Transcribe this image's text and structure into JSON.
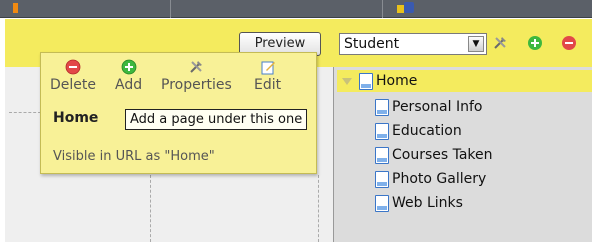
{
  "toolbar": {
    "preview_label": "Preview",
    "role_select_value": "Student"
  },
  "popup": {
    "actions": [
      {
        "label": "Delete",
        "icon": "delete-icon"
      },
      {
        "label": "Add",
        "icon": "add-icon"
      },
      {
        "label": "Properties",
        "icon": "properties-icon"
      },
      {
        "label": "Edit",
        "icon": "edit-icon"
      }
    ],
    "page_name": "Home",
    "url_note": "Visible in URL as \"Home\"",
    "tooltip": "Add a page under this one"
  },
  "tree": {
    "root": "Home",
    "children": [
      "Personal Info",
      "Education",
      "Courses Taken",
      "Photo Gallery",
      "Web Links"
    ]
  },
  "colors": {
    "highlight_yellow": "#f4eb5e",
    "popup_yellow": "#f8f197",
    "add_green": "#3eb83e",
    "delete_red": "#e24848"
  }
}
